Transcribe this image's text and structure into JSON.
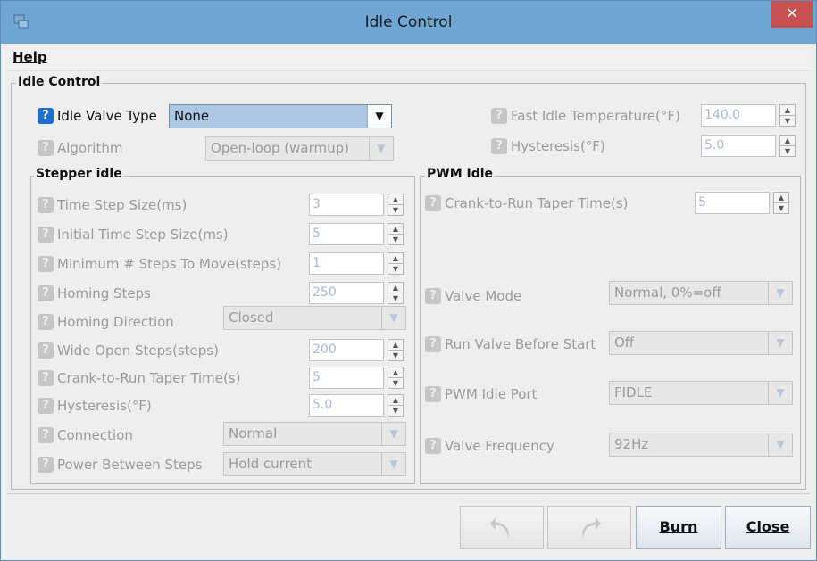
{
  "window": {
    "title": "Idle Control",
    "close_label": "×"
  },
  "menu": {
    "help_label": "Help"
  },
  "idle_control": {
    "legend": "Idle Control",
    "idle_valve_type": {
      "label": "Idle Valve Type",
      "value": "None"
    },
    "algorithm": {
      "label": "Algorithm",
      "value": "Open-loop (warmup)"
    },
    "fast_idle_temp": {
      "label": "Fast Idle Temperature(°F)",
      "value": "140.0"
    },
    "hysteresis": {
      "label": "Hysteresis(°F)",
      "value": "5.0"
    }
  },
  "stepper": {
    "legend": "Stepper idle",
    "time_step": {
      "label": "Time Step Size(ms)",
      "value": "3"
    },
    "initial_time_step": {
      "label": "Initial Time Step Size(ms)",
      "value": "5"
    },
    "min_steps": {
      "label": "Minimum # Steps To Move(steps)",
      "value": "1"
    },
    "homing_steps": {
      "label": "Homing Steps",
      "value": "250"
    },
    "homing_direction": {
      "label": "Homing Direction",
      "value": "Closed"
    },
    "wide_open_steps": {
      "label": "Wide Open Steps(steps)",
      "value": "200"
    },
    "crank_taper": {
      "label": "Crank-to-Run Taper Time(s)",
      "value": "5"
    },
    "hysteresis": {
      "label": "Hysteresis(°F)",
      "value": "5.0"
    },
    "connection": {
      "label": "Connection",
      "value": "Normal"
    },
    "power_between": {
      "label": "Power Between Steps",
      "value": "Hold current"
    }
  },
  "pwm": {
    "legend": "PWM Idle",
    "crank_taper": {
      "label": "Crank-to-Run Taper Time(s)",
      "value": "5"
    },
    "valve_mode": {
      "label": "Valve Mode",
      "value": "Normal, 0%=off"
    },
    "run_before_start": {
      "label": "Run Valve Before Start",
      "value": "Off"
    },
    "idle_port": {
      "label": "PWM Idle Port",
      "value": "FIDLE"
    },
    "valve_frequency": {
      "label": "Valve Frequency",
      "value": "92Hz"
    }
  },
  "buttons": {
    "burn": "Burn",
    "close": "Close"
  },
  "colors": {
    "titlebar": "#6fa6d3",
    "close": "#c75050",
    "help_icon_active": "#1d6fd6"
  }
}
